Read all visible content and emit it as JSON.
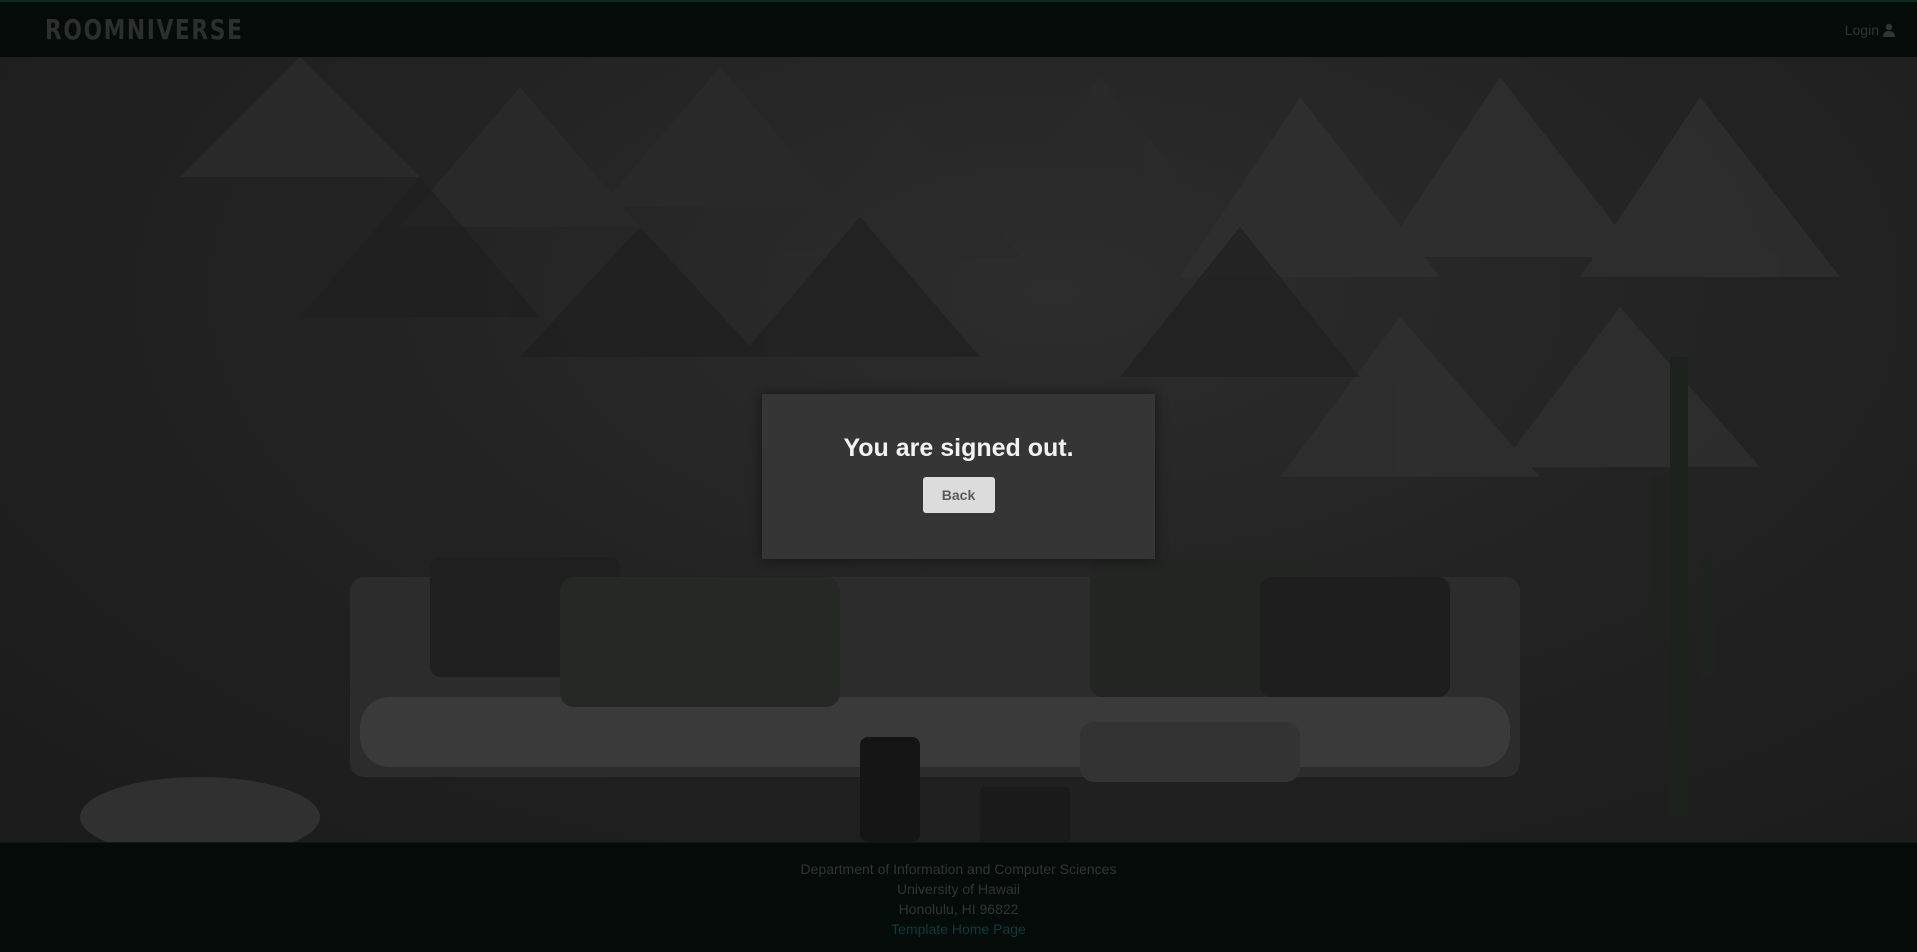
{
  "navbar": {
    "brand": "ROOMNIVERSE",
    "login_label": "Login",
    "login_icon": "user-icon"
  },
  "main": {
    "message": "You are signed out.",
    "back_label": "Back"
  },
  "footer": {
    "line1": "Department of Information and Computer Sciences",
    "line2": "University of Hawaii",
    "line3": "Honolulu, HI 96822",
    "link": "Template Home Page"
  },
  "colors": {
    "nav_bg": "#040b08",
    "panel_bg": "#353535",
    "button_bg": "#dcdcdc",
    "link": "#0d3b3e"
  }
}
